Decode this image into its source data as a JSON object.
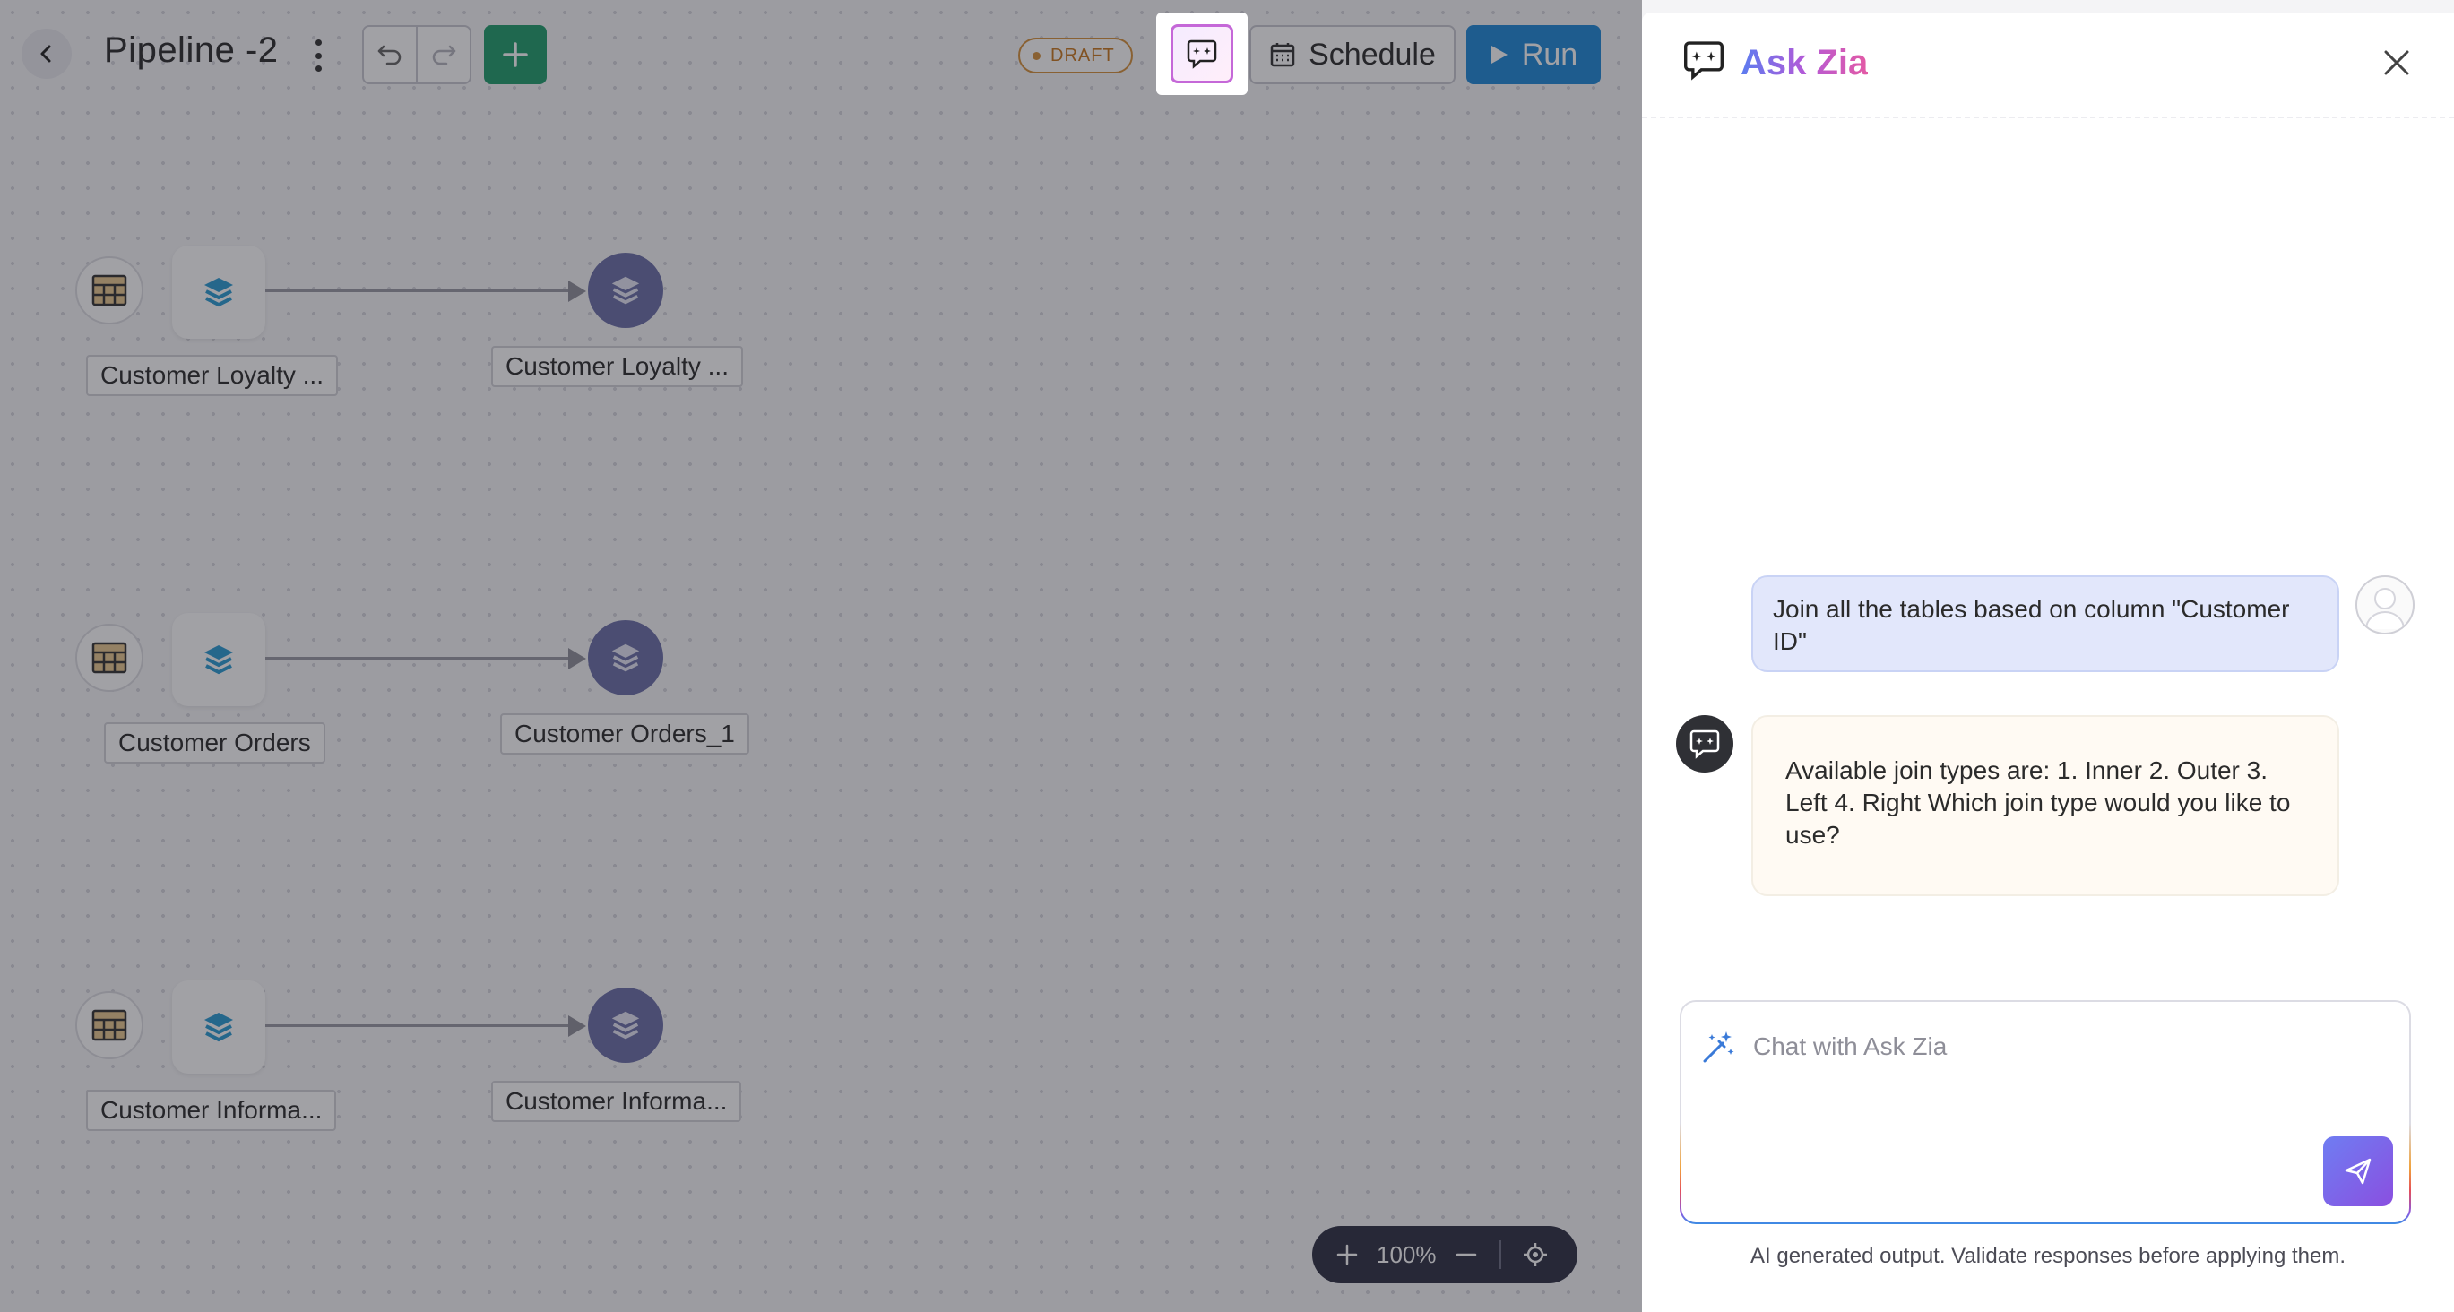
{
  "header": {
    "title": "Pipeline -2",
    "draft_badge": "DRAFT",
    "schedule_label": "Schedule",
    "run_label": "Run"
  },
  "pipelines": [
    {
      "source_label": "Customer Loyalty ...",
      "dest_label": "Customer Loyalty ..."
    },
    {
      "source_label": "Customer Orders",
      "dest_label": "Customer Orders_1"
    },
    {
      "source_label": "Customer Informa...",
      "dest_label": "Customer Informa..."
    }
  ],
  "zoom": {
    "level": "100%"
  },
  "panel": {
    "title": "Ask Zia",
    "user_message": "Join all the tables based on column \"Customer ID\"",
    "bot_message": "Available join types are: 1. Inner 2. Outer 3. Left 4. Right Which join type would you like to use?",
    "chat_placeholder": "Chat with Ask Zia",
    "disclaimer": "AI generated output. Validate responses before applying them."
  },
  "colors": {
    "run_button": "#1e88d8",
    "add_button": "#1f9d6b",
    "draft_badge": "#d6923c",
    "dest_node": "#6b6fa8",
    "user_bubble": "#e2e7fb",
    "bot_bubble": "#fffaf3"
  },
  "icons": [
    "back-icon",
    "kebab-icon",
    "undo-icon",
    "redo-icon",
    "plus-icon",
    "ask-zia-icon",
    "calendar-icon",
    "play-icon",
    "table-icon",
    "layers-icon",
    "close-icon",
    "magic-wand-icon",
    "send-icon",
    "zoom-in-icon",
    "zoom-out-icon",
    "recenter-icon"
  ]
}
